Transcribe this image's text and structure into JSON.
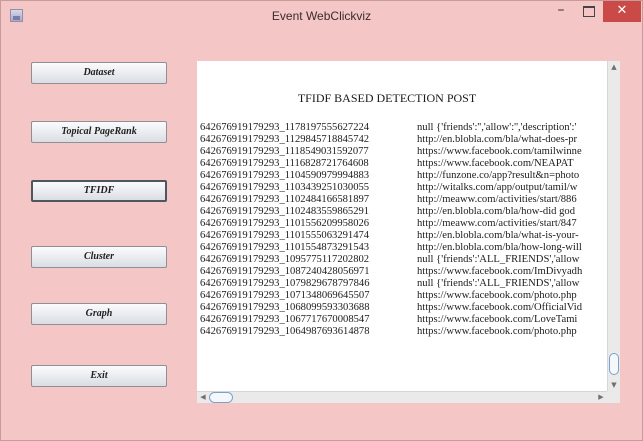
{
  "window": {
    "title": "Event WebClickviz",
    "minimize_glyph": "–",
    "close_glyph": "✕"
  },
  "sidebar": {
    "buttons": [
      {
        "label": "Dataset",
        "active": false
      },
      {
        "label": "Topical PageRank",
        "active": false
      },
      {
        "label": "TFIDF",
        "active": true
      },
      {
        "label": "Cluster",
        "active": false
      },
      {
        "label": "Graph",
        "active": false
      },
      {
        "label": "Exit",
        "active": false
      }
    ]
  },
  "panel": {
    "title": "TFIDF BASED DETECTION POST",
    "rows": [
      {
        "id": "642676919179293_1178197555627224",
        "value": "null  {'friends':'','allow':'','description':'"
      },
      {
        "id": "642676919179293_1129845718845742",
        "value": "http://en.blobla.com/bla/what-does-pr"
      },
      {
        "id": "642676919179293_1118549031592077",
        "value": "https://www.facebook.com/tamilwinne"
      },
      {
        "id": "642676919179293_1116828721764608",
        "value": "https://www.facebook.com/NEAPAT"
      },
      {
        "id": "642676919179293_1104590979994883",
        "value": "http://funzone.co/app?result&n=photo"
      },
      {
        "id": "642676919179293_1103439251030055",
        "value": "http://witalks.com/app/output/tamil/w"
      },
      {
        "id": "642676919179293_1102484166581897",
        "value": "http://meaww.com/activities/start/886"
      },
      {
        "id": "642676919179293_1102483559865291",
        "value": "http://en.blobla.com/bla/how-did god"
      },
      {
        "id": "642676919179293_1101556209958026",
        "value": "http://meaww.com/activities/start/847"
      },
      {
        "id": "642676919179293_1101555063291474",
        "value": "http://en.blobla.com/bla/what-is-your-"
      },
      {
        "id": "642676919179293_1101554873291543",
        "value": "http://en.blobla.com/bla/how-long-will"
      },
      {
        "id": "642676919179293_1095775117202802",
        "value": "null  {'friends':'ALL_FRIENDS','allow"
      },
      {
        "id": "642676919179293_1087240428056971",
        "value": "https://www.facebook.com/ImDivyadh"
      },
      {
        "id": "642676919179293_1079829678797846",
        "value": "null  {'friends':'ALL_FRIENDS','allow"
      },
      {
        "id": "642676919179293_1071348069645507",
        "value": "https://www.facebook.com/photo.php"
      },
      {
        "id": "642676919179293_1068099593303688",
        "value": "https://www.facebook.com/OfficialVid"
      },
      {
        "id": "642676919179293_1067717670008547",
        "value": "https://www.facebook.com/LoveTami"
      },
      {
        "id": "642676919179293_1064987693614878",
        "value": "https://www.facebook.com/photo.php"
      }
    ]
  },
  "scroll": {
    "up_glyph": "▲",
    "down_glyph": "▼",
    "left_glyph": "◀",
    "right_glyph": "▶"
  }
}
